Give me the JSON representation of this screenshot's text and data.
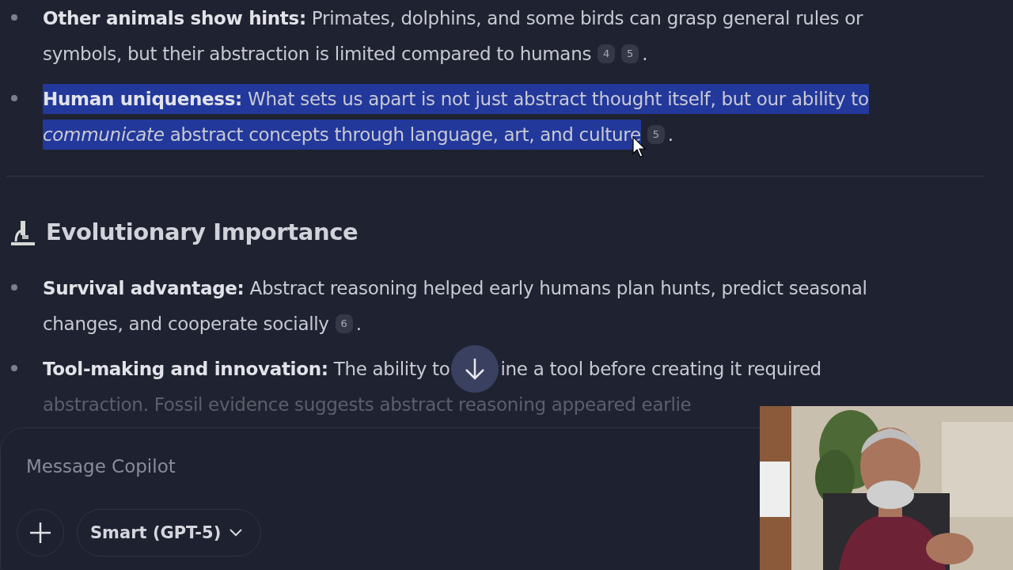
{
  "messages": [
    {
      "kind": "bullet",
      "selected": false,
      "lines": [
        {
          "text": "**Other animals show hints:** Primates, dolphins, and some birds can grasp general rules or",
          "faded": false
        },
        {
          "text": "symbols, but their abstraction is limited compared to humans",
          "faded": false
        }
      ],
      "citations": [
        "4",
        "5"
      ],
      "end": "."
    },
    {
      "kind": "bullet",
      "selected": true,
      "lines": [
        {
          "text": "**Human uniqueness:** What sets us apart is not just abstract thought itself, but our ability to",
          "faded": false
        },
        {
          "text": "*communicate* abstract concepts through language, art, and culture",
          "faded": false
        }
      ],
      "citations": [
        "5"
      ],
      "end": "."
    },
    {
      "kind": "divider"
    },
    {
      "kind": "heading",
      "title": "Evolutionary Importance"
    },
    {
      "kind": "bullet",
      "selected": false,
      "lines": [
        {
          "text": "**Survival advantage:** Abstract reasoning helped early humans plan hunts, predict seasonal",
          "faded": false
        },
        {
          "text": "changes, and cooperate socially",
          "faded": false
        }
      ],
      "citations": [
        "6"
      ],
      "end": "."
    },
    {
      "kind": "bullet",
      "selected": false,
      "lines": [
        {
          "text": "**Tool-making and innovation:** The ability to",
          "continuation": "ine a tool before creating it required",
          "faded": false
        },
        {
          "text": "abstraction. Fossil evidence suggests abstract reasoning appeared earlie",
          "faded": true
        }
      ]
    }
  ],
  "composer": {
    "placeholder": "Message Copilot",
    "model": "Smart (GPT-5)"
  }
}
